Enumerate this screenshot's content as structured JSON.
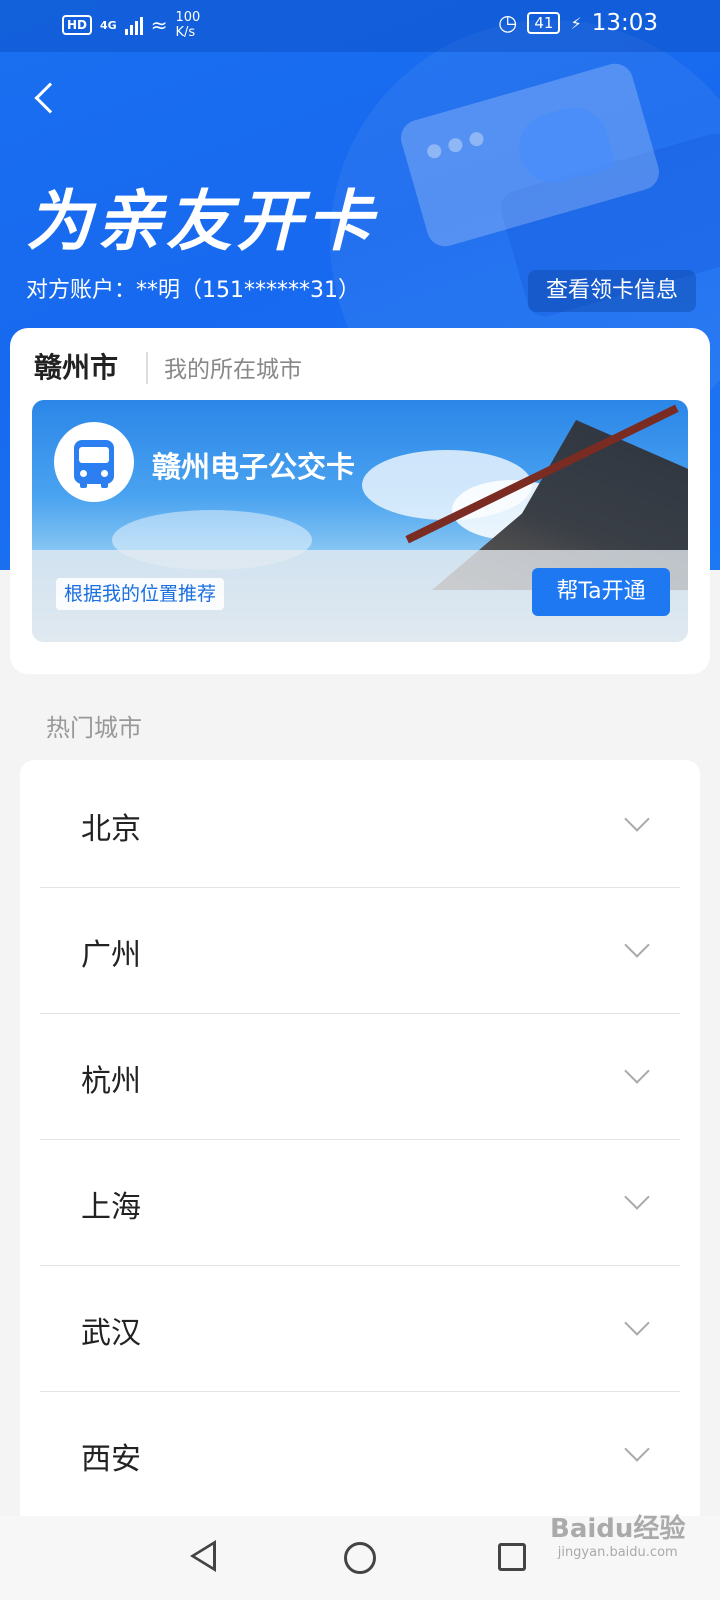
{
  "status_bar": {
    "hd": "HD",
    "network": "4G",
    "speed_value": "100",
    "speed_unit": "K/s",
    "battery": "41",
    "time": "13:03"
  },
  "header": {
    "title": "为亲友开卡",
    "account_label": "对方账户：**明（151******31）",
    "card_info_button": "查看领卡信息"
  },
  "location_card": {
    "city": "赣州市",
    "subtitle": "我的所在城市",
    "card_name": "赣州电子公交卡",
    "recommend_tag": "根据我的位置推荐",
    "open_button": "帮Ta开通"
  },
  "hot_cities": {
    "title": "热门城市",
    "items": [
      {
        "name": "北京"
      },
      {
        "name": "广州"
      },
      {
        "name": "杭州"
      },
      {
        "name": "上海"
      },
      {
        "name": "武汉"
      },
      {
        "name": "西安"
      }
    ]
  },
  "watermark": {
    "brand": "Baidu经验",
    "url": "jingyan.baidu.com"
  },
  "colors": {
    "primary": "#1769ef",
    "button": "#1d78f2",
    "background": "#f4f4f4"
  }
}
